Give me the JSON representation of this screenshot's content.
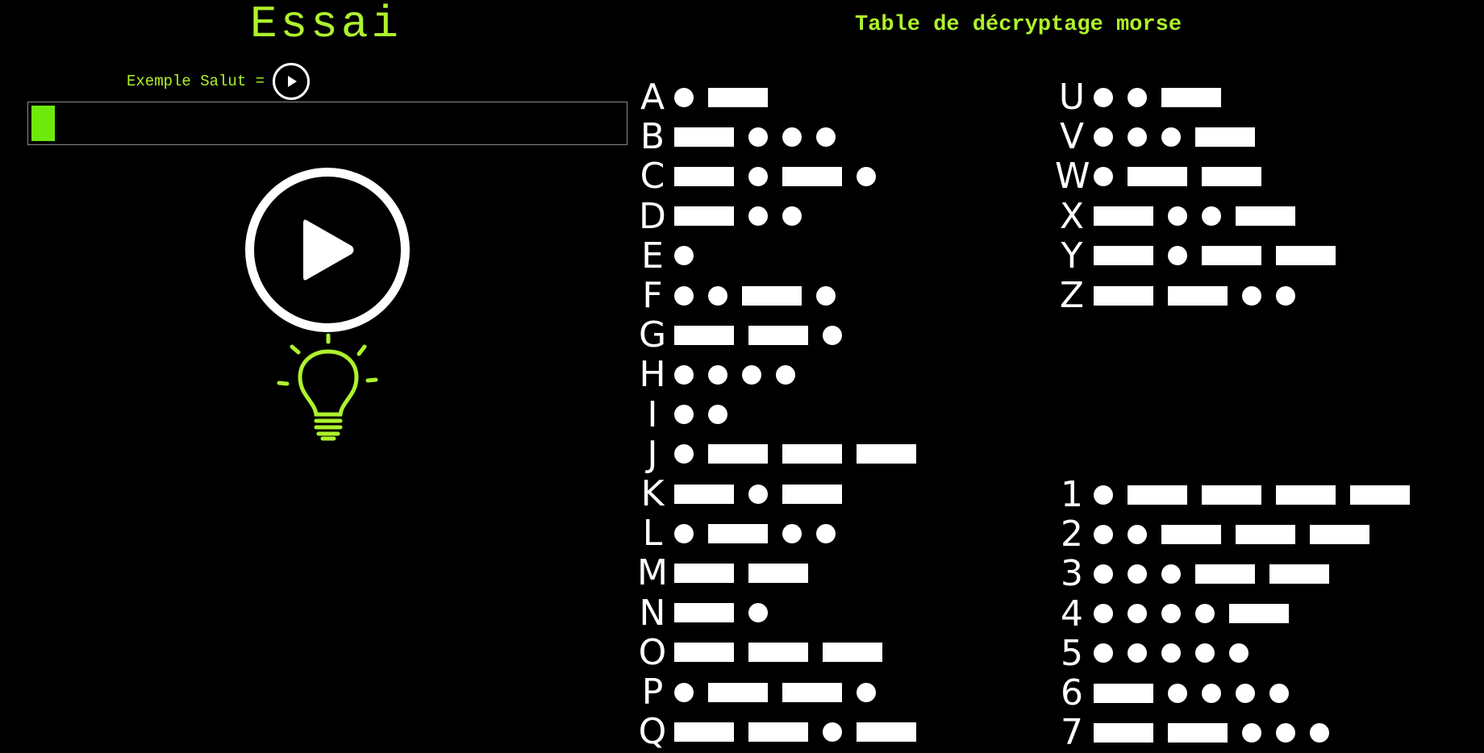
{
  "page": {
    "title": "Essai",
    "example_label": "Exemple Salut =",
    "table_title": "Table de décryptage morse"
  },
  "colors": {
    "accent": "#aef22c",
    "progress": "#6ee90c",
    "background": "#000000",
    "symbols": "#ffffff"
  },
  "icons": {
    "small_play": "play-circle-icon",
    "big_play": "play-circle-icon",
    "hint": "lightbulb-icon"
  },
  "progress": 0.04,
  "morse": {
    "letters_a_q": [
      {
        "char": "A",
        "code": ".-"
      },
      {
        "char": "B",
        "code": "-..."
      },
      {
        "char": "C",
        "code": "-.-."
      },
      {
        "char": "D",
        "code": "-.."
      },
      {
        "char": "E",
        "code": "."
      },
      {
        "char": "F",
        "code": "..-."
      },
      {
        "char": "G",
        "code": "--."
      },
      {
        "char": "H",
        "code": "...."
      },
      {
        "char": "I",
        "code": ".."
      },
      {
        "char": "J",
        "code": ".---"
      },
      {
        "char": "K",
        "code": "-.-"
      },
      {
        "char": "L",
        "code": ".-.."
      },
      {
        "char": "M",
        "code": "--"
      },
      {
        "char": "N",
        "code": "-."
      },
      {
        "char": "O",
        "code": "---"
      },
      {
        "char": "P",
        "code": ".--."
      },
      {
        "char": "Q",
        "code": "--.-"
      }
    ],
    "letters_u_z": [
      {
        "char": "U",
        "code": "..-"
      },
      {
        "char": "V",
        "code": "...-"
      },
      {
        "char": "W",
        "code": ".--"
      },
      {
        "char": "X",
        "code": "-..-"
      },
      {
        "char": "Y",
        "code": "-.--"
      },
      {
        "char": "Z",
        "code": "--.."
      }
    ],
    "digits": [
      {
        "char": "1",
        "code": ".----"
      },
      {
        "char": "2",
        "code": "..---"
      },
      {
        "char": "3",
        "code": "...--"
      },
      {
        "char": "4",
        "code": "....-"
      },
      {
        "char": "5",
        "code": "....."
      },
      {
        "char": "6",
        "code": "-...."
      },
      {
        "char": "7",
        "code": "--..."
      }
    ]
  }
}
